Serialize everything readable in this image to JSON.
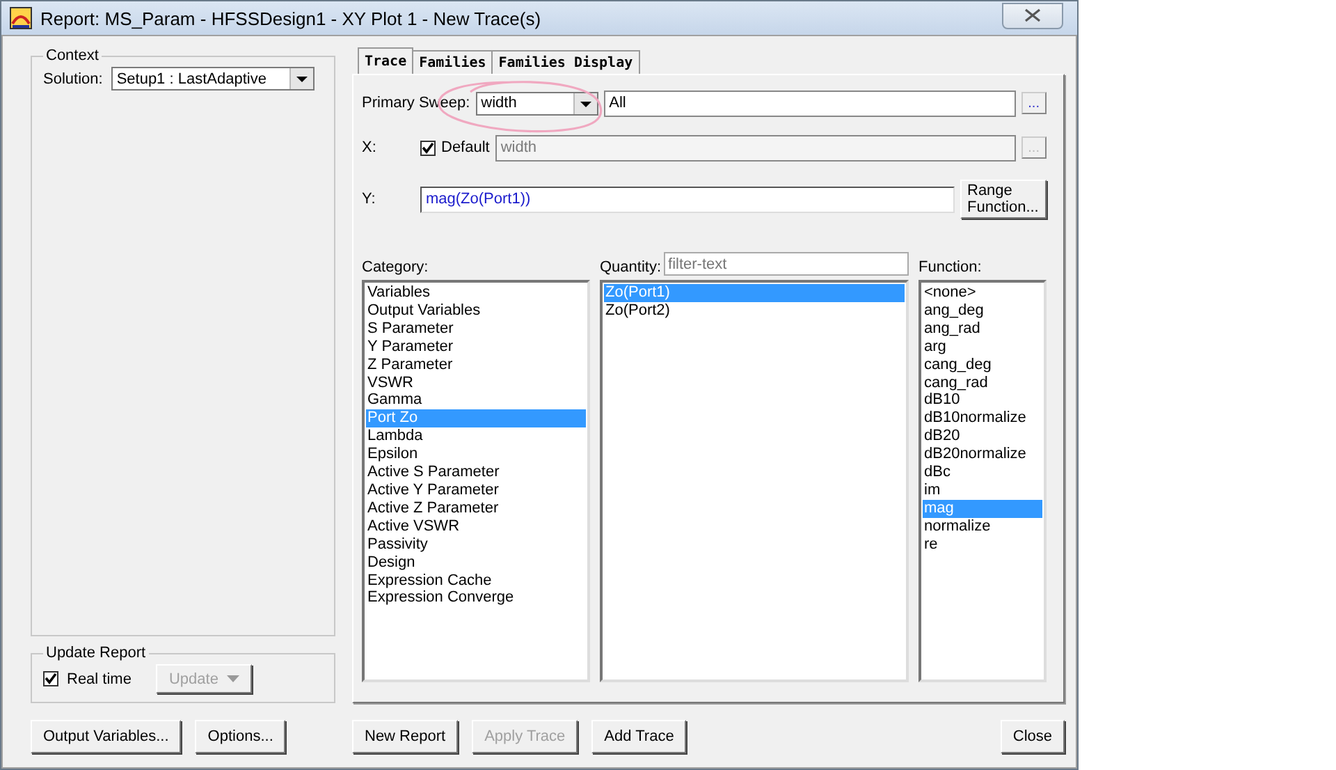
{
  "window": {
    "title": "Report: MS_Param - HFSSDesign1 - XY Plot 1 - New Trace(s)"
  },
  "context": {
    "title": "Context",
    "solution_label": "Solution:",
    "solution_value": "Setup1 : LastAdaptive"
  },
  "update_report": {
    "title": "Update Report",
    "realtime_label": "Real time",
    "realtime_checked": true,
    "update_button": {
      "label": "Update",
      "disabled": true
    }
  },
  "tabs": [
    {
      "label": "Trace",
      "selected": true
    },
    {
      "label": "Families",
      "selected": false
    },
    {
      "label": "Families Display",
      "selected": false
    }
  ],
  "primary_sweep": {
    "label": "Primary Sweep:",
    "value": "width",
    "range": "All",
    "browse": "..."
  },
  "x": {
    "label": "X:",
    "default_label": "Default",
    "default_checked": true,
    "value": "width",
    "browse": "..."
  },
  "y": {
    "label": "Y:",
    "value": "mag(Zo(Port1))",
    "range_button": "Range Function..."
  },
  "category": {
    "label": "Category:",
    "items": [
      {
        "label": "Variables",
        "selected": false
      },
      {
        "label": "Output Variables",
        "selected": false
      },
      {
        "label": "S Parameter",
        "selected": false
      },
      {
        "label": "Y Parameter",
        "selected": false
      },
      {
        "label": "Z Parameter",
        "selected": false
      },
      {
        "label": "VSWR",
        "selected": false
      },
      {
        "label": "Gamma",
        "selected": false
      },
      {
        "label": "Port Zo",
        "selected": true
      },
      {
        "label": "Lambda",
        "selected": false
      },
      {
        "label": "Epsilon",
        "selected": false
      },
      {
        "label": "Active S Parameter",
        "selected": false
      },
      {
        "label": "Active Y Parameter",
        "selected": false
      },
      {
        "label": "Active Z Parameter",
        "selected": false
      },
      {
        "label": "Active VSWR",
        "selected": false
      },
      {
        "label": "Passivity",
        "selected": false
      },
      {
        "label": "Design",
        "selected": false
      },
      {
        "label": "Expression Cache",
        "selected": false
      },
      {
        "label": "Expression Converge",
        "selected": false
      }
    ]
  },
  "quantity": {
    "label": "Quantity:",
    "placeholder": "filter-text",
    "items": [
      {
        "label": "Zo(Port1)",
        "selected": true
      },
      {
        "label": "Zo(Port2)",
        "selected": false
      }
    ]
  },
  "function": {
    "label": "Function:",
    "items": [
      {
        "label": "<none>",
        "selected": false
      },
      {
        "label": "ang_deg",
        "selected": false
      },
      {
        "label": "ang_rad",
        "selected": false
      },
      {
        "label": "arg",
        "selected": false
      },
      {
        "label": "cang_deg",
        "selected": false
      },
      {
        "label": "cang_rad",
        "selected": false
      },
      {
        "label": "dB10",
        "selected": false
      },
      {
        "label": "dB10normalize",
        "selected": false
      },
      {
        "label": "dB20",
        "selected": false
      },
      {
        "label": "dB20normalize",
        "selected": false
      },
      {
        "label": "dBc",
        "selected": false
      },
      {
        "label": "im",
        "selected": false
      },
      {
        "label": "mag",
        "selected": true
      },
      {
        "label": "normalize",
        "selected": false
      },
      {
        "label": "re",
        "selected": false
      }
    ]
  },
  "left_buttons": [
    {
      "label": "Output Variables...",
      "disabled": false
    },
    {
      "label": "Options...",
      "disabled": false
    }
  ],
  "bottom_buttons": [
    {
      "label": "New Report",
      "disabled": false
    },
    {
      "label": "Apply Trace",
      "disabled": true
    },
    {
      "label": "Add Trace",
      "disabled": false
    }
  ],
  "close_button": {
    "label": "Close",
    "disabled": false
  }
}
